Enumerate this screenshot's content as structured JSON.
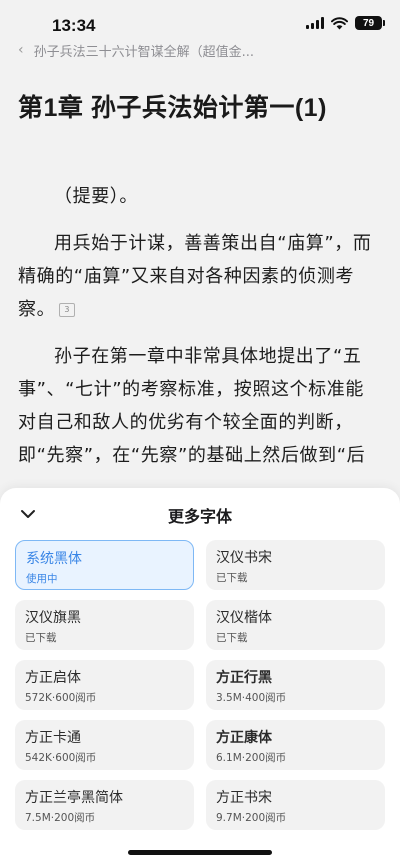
{
  "status_bar": {
    "time": "13:34",
    "battery": "79"
  },
  "reader": {
    "breadcrumb": "孙子兵法三十六计智谋全解（超值金...",
    "chapter_title": "第1章 孙子兵法始计第一(1)",
    "paragraphs": [
      "（提要）。",
      "用兵始于计谋，善善策出自“庙算”，而精确的“庙算”又来自对各种因素的侦测考察。",
      "孙子在第一章中非常具体地提出了“五事”、“七计”的考察标准，按照这个标准能对自己和敌人的优劣有个较全面的判断，即“先察”，在“先察”的基础上然后做到“后"
    ],
    "note_number": "3"
  },
  "sheet": {
    "title": "更多字体",
    "fonts": [
      {
        "name": "系统黑体",
        "meta": "使用中"
      },
      {
        "name": "汉仪书宋",
        "meta": "已下载"
      },
      {
        "name": "汉仪旗黑",
        "meta": "已下载"
      },
      {
        "name": "汉仪楷体",
        "meta": "已下载"
      },
      {
        "name": "方正启体",
        "meta": "572K·600阅币"
      },
      {
        "name": "方正行黑",
        "meta": "3.5M·400阅币"
      },
      {
        "name": "方正卡通",
        "meta": "542K·600阅币"
      },
      {
        "name": "方正康体",
        "meta": "6.1M·200阅币"
      },
      {
        "name": "方正兰亭黑简体",
        "meta": "7.5M·200阅币"
      },
      {
        "name": "方正书宋",
        "meta": "9.7M·200阅币"
      }
    ]
  },
  "colors": {
    "accent": "#3a86e6",
    "selected_bg": "#e9f3ff"
  }
}
